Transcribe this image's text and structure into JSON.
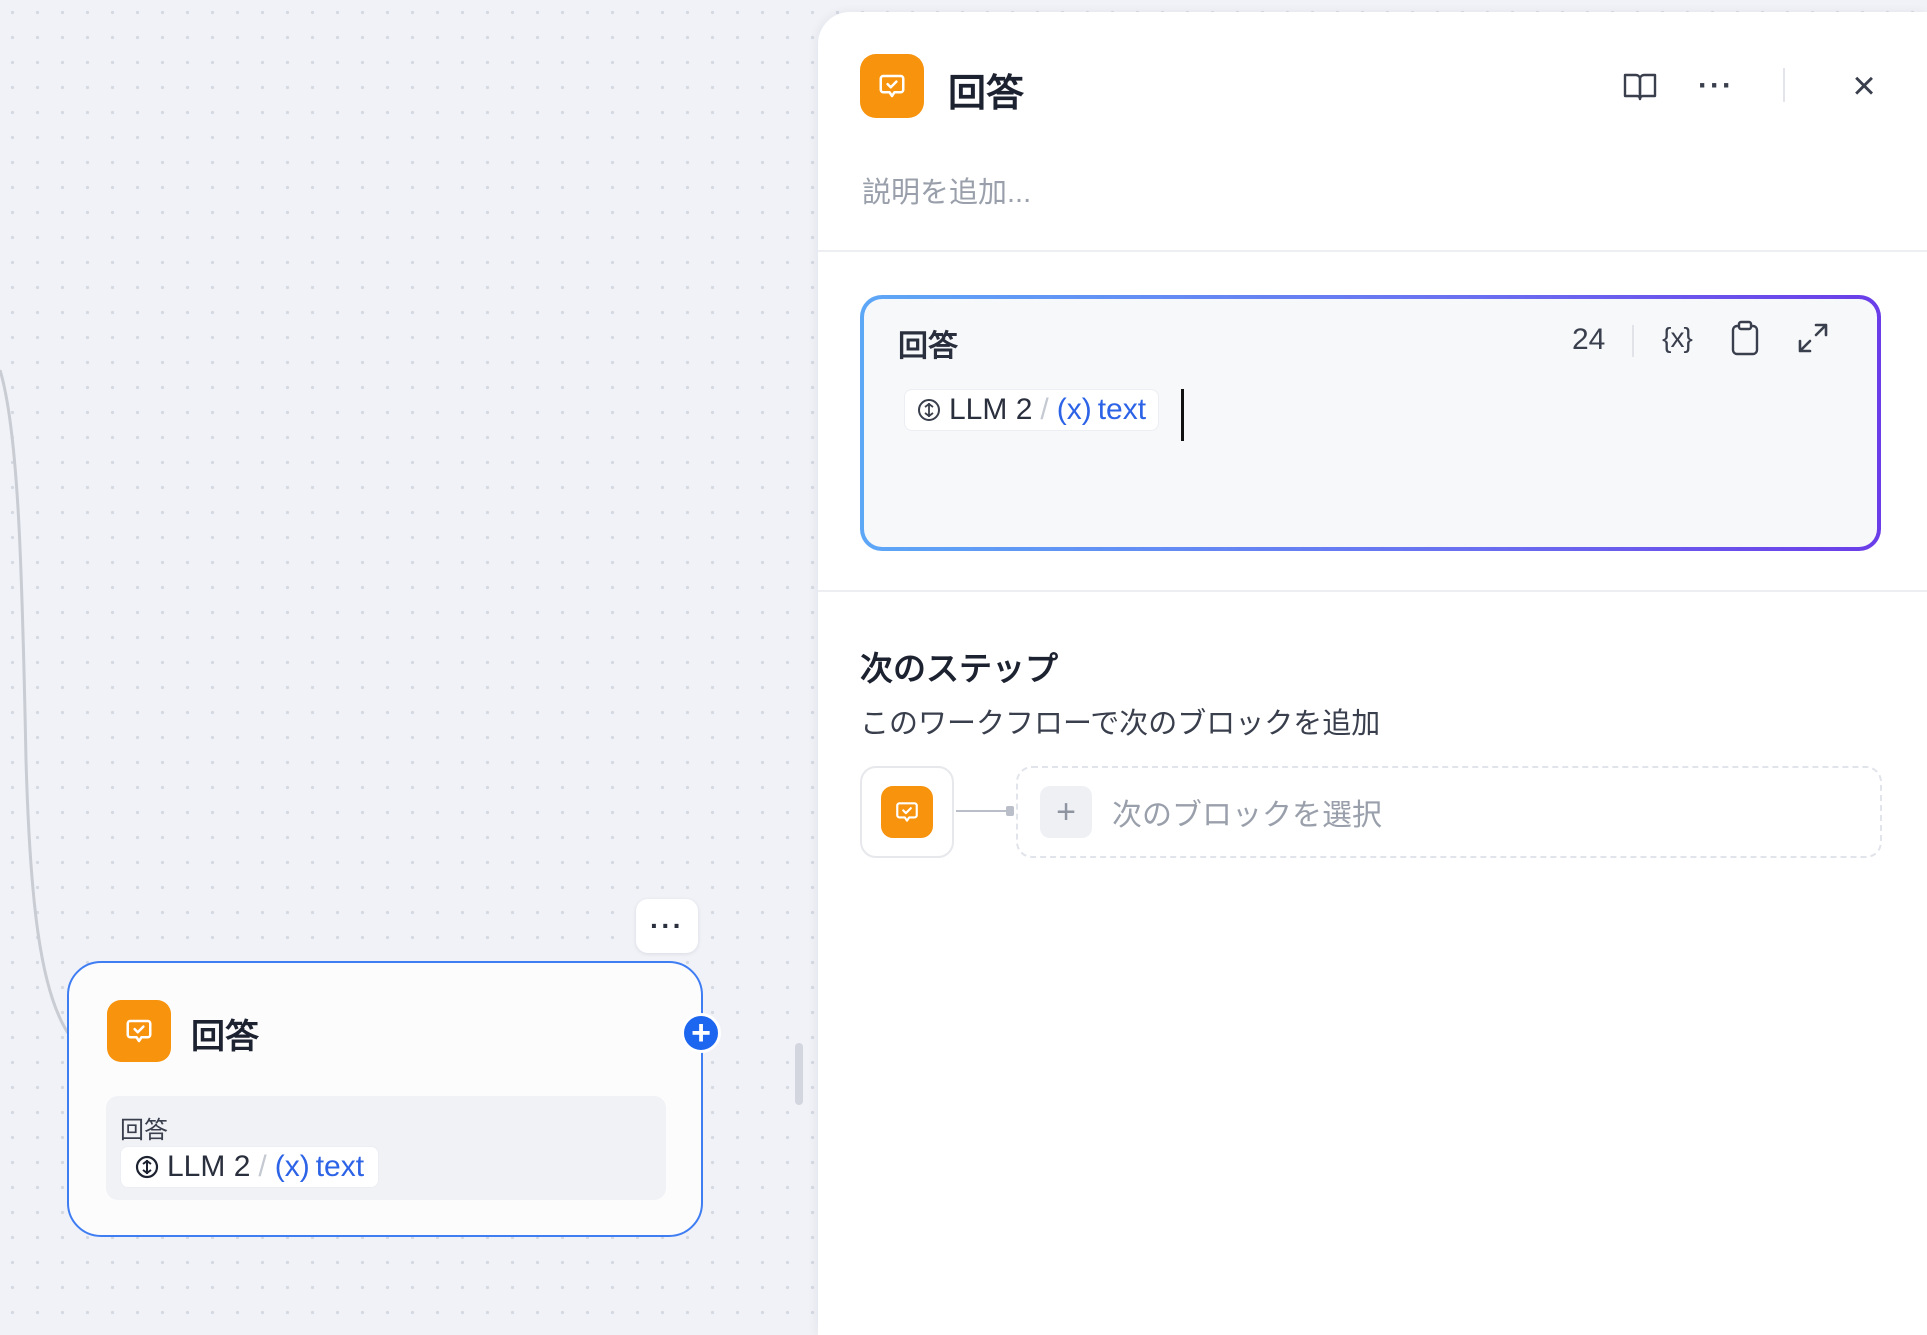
{
  "canvas": {
    "node": {
      "title": "回答",
      "field_label": "回答",
      "ref": {
        "source": "LLM 2",
        "separator": "/",
        "var_icon": "(x)",
        "var": "text"
      },
      "add_icon": "+",
      "more_icon": "···"
    }
  },
  "panel": {
    "title": "回答",
    "description_placeholder": "説明を追加...",
    "header": {
      "docs_icon": "book-icon",
      "more_icon": "···",
      "close_icon": "×"
    },
    "editor": {
      "label": "回答",
      "char_count": "24",
      "var_button": "{x}",
      "ref": {
        "source": "LLM 2",
        "separator": "/",
        "var_icon": "(x)",
        "var": "text"
      }
    },
    "next_step": {
      "title": "次のステップ",
      "subtitle": "このワークフローで次のブロックを追加",
      "select_label": "次のブロックを選択",
      "plus": "+"
    }
  },
  "colors": {
    "accent_orange": "#f7930c",
    "accent_blue": "#1c66f0",
    "variable_blue": "#2d63e6",
    "node_border": "#3f7df3"
  }
}
